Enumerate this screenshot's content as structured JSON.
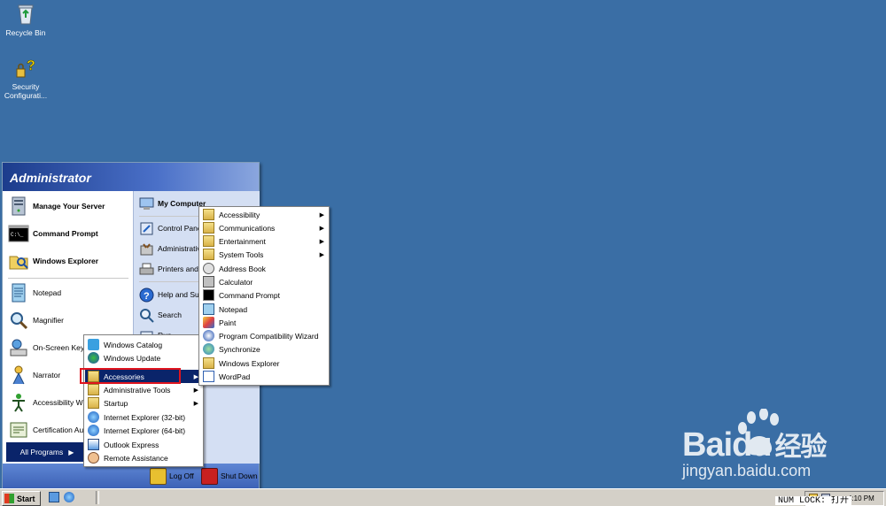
{
  "desktop": {
    "icons": [
      {
        "label": "Recycle Bin",
        "icon": "recycle-bin-icon"
      },
      {
        "label": "Security Configurati...",
        "icon": "security-config-icon"
      }
    ]
  },
  "start_menu": {
    "user": "Administrator",
    "pinned": [
      {
        "label": "Manage Your Server",
        "icon": "server-icon"
      },
      {
        "label": "Command Prompt",
        "icon": "cmd-icon"
      },
      {
        "label": "Windows Explorer",
        "icon": "explorer-icon"
      }
    ],
    "recent": [
      {
        "label": "Notepad",
        "icon": "notepad-icon"
      },
      {
        "label": "Magnifier",
        "icon": "magnifier-icon"
      },
      {
        "label": "On-Screen Keyb",
        "icon": "keyboard-icon"
      },
      {
        "label": "Narrator",
        "icon": "narrator-icon"
      },
      {
        "label": "Accessibility Wiz",
        "icon": "accessibility-icon"
      },
      {
        "label": "Certification Au",
        "icon": "certificate-icon"
      }
    ],
    "all_programs": "All Programs",
    "right": [
      {
        "label": "My Computer",
        "icon": "computer-icon",
        "bold": true
      },
      {
        "label": "Control Panel",
        "icon": "control-panel-icon"
      },
      {
        "label": "Administrative Tools",
        "icon": "admin-tools-icon"
      },
      {
        "label": "Printers and Faxes",
        "icon": "printer-icon"
      },
      {
        "label": "Help and Support",
        "icon": "help-icon"
      },
      {
        "label": "Search",
        "icon": "search-icon"
      },
      {
        "label": "Run...",
        "icon": "run-icon"
      }
    ],
    "log_off": "Log Off",
    "shut_down": "Shut Down"
  },
  "programs_menu": {
    "items": [
      {
        "label": "Windows Catalog",
        "icon": "catalog-icon"
      },
      {
        "label": "Windows Update",
        "icon": "update-icon"
      },
      {
        "label": "Accessories",
        "icon": "folder-icon",
        "submenu": true,
        "selected": true
      },
      {
        "label": "Administrative Tools",
        "icon": "folder-icon",
        "submenu": true
      },
      {
        "label": "Startup",
        "icon": "folder-icon",
        "submenu": true
      },
      {
        "label": "Internet Explorer (32-bit)",
        "icon": "ie-icon"
      },
      {
        "label": "Internet Explorer (64-bit)",
        "icon": "ie-icon"
      },
      {
        "label": "Outlook Express",
        "icon": "outlook-icon"
      },
      {
        "label": "Remote Assistance",
        "icon": "remote-assistance-icon"
      }
    ]
  },
  "accessories_menu": {
    "items": [
      {
        "label": "Accessibility",
        "icon": "folder-icon",
        "submenu": true
      },
      {
        "label": "Communications",
        "icon": "folder-icon",
        "submenu": true
      },
      {
        "label": "Entertainment",
        "icon": "folder-icon",
        "submenu": true
      },
      {
        "label": "System Tools",
        "icon": "folder-icon",
        "submenu": true
      },
      {
        "label": "Address Book",
        "icon": "address-book-icon"
      },
      {
        "label": "Calculator",
        "icon": "calculator-icon"
      },
      {
        "label": "Command Prompt",
        "icon": "cmd-icon"
      },
      {
        "label": "Notepad",
        "icon": "notepad-icon"
      },
      {
        "label": "Paint",
        "icon": "paint-icon"
      },
      {
        "label": "Program Compatibility Wizard",
        "icon": "compat-wizard-icon"
      },
      {
        "label": "Synchronize",
        "icon": "sync-icon"
      },
      {
        "label": "Windows Explorer",
        "icon": "explorer-icon"
      },
      {
        "label": "WordPad",
        "icon": "wordpad-icon"
      }
    ]
  },
  "taskbar": {
    "start_label": "Start",
    "clock": "4:10 PM",
    "numlock": "NUM LOCK: 打开"
  },
  "watermark": {
    "brand": "Baidu",
    "brand_cn": "经验",
    "url": "jingyan.baidu.com"
  },
  "colors": {
    "desktop": "#3a6ea5",
    "menu_highlight": "#0a246a",
    "annotation_box": "#e0141e"
  }
}
